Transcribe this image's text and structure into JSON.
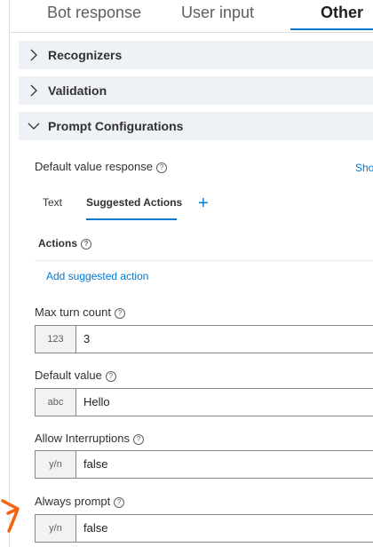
{
  "tabs": [
    {
      "label": "Bot response"
    },
    {
      "label": "User input"
    },
    {
      "label": "Other",
      "selected": true
    }
  ],
  "sections": [
    {
      "label": "Recognizers",
      "expanded": false
    },
    {
      "label": "Validation",
      "expanded": false
    },
    {
      "label": "Prompt Configurations",
      "expanded": true
    }
  ],
  "prompt": {
    "default_value_response": {
      "label": "Default value response",
      "show_link": "Show",
      "subtabs": [
        {
          "label": "Text"
        },
        {
          "label": "Suggested Actions",
          "selected": true
        }
      ],
      "add_icon": "plus-icon",
      "actions_label": "Actions",
      "add_action_link": "Add suggested action"
    },
    "fields": [
      {
        "label": "Max turn count",
        "prefix": "123",
        "value": "3"
      },
      {
        "label": "Default value",
        "prefix": "abc",
        "value": "Hello"
      },
      {
        "label": "Allow Interruptions",
        "prefix": "y/n",
        "value": "false"
      },
      {
        "label": "Always prompt",
        "prefix": "y/n",
        "value": "false"
      }
    ]
  },
  "colors": {
    "accent": "#0078d4",
    "section_bg": "#eef2f7",
    "annotation": "#f7630c"
  }
}
